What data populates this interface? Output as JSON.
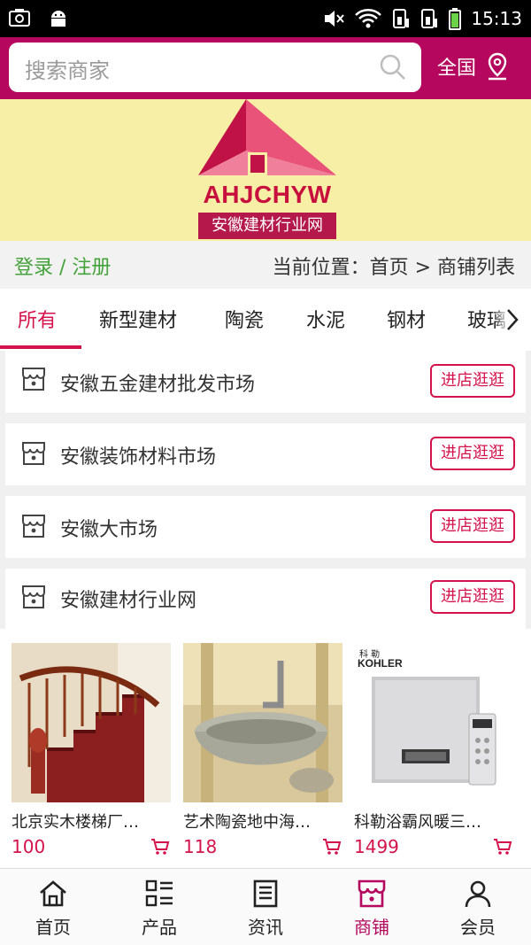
{
  "statusbar": {
    "time": "15:13"
  },
  "header": {
    "search_placeholder": "搜索商家",
    "region": "全国"
  },
  "banner": {
    "logo_text": "AHJCHYW",
    "logo_subtitle": "安徽建材行业网"
  },
  "crumb": {
    "login": "登录 / 注册",
    "location": "当前位置：首页 > 商铺列表"
  },
  "tabs": [
    "所有",
    "新型建材",
    "陶瓷",
    "水泥",
    "钢材",
    "玻璃"
  ],
  "shops": [
    {
      "name": "安徽五金建材批发市场",
      "button": "进店逛逛"
    },
    {
      "name": "安徽装饰材料市场",
      "button": "进店逛逛"
    },
    {
      "name": "安徽大市场",
      "button": "进店逛逛"
    },
    {
      "name": "安徽建材行业网",
      "button": "进店逛逛"
    }
  ],
  "products": [
    {
      "name": "北京实木楼梯厂…",
      "price": "100"
    },
    {
      "name": "艺术陶瓷地中海…",
      "price": "118"
    },
    {
      "name": "科勒浴霸风暖三…",
      "price": "1499",
      "brand": "KOHLER",
      "brand_cn": "科 勒"
    }
  ],
  "nav": [
    {
      "label": "首页",
      "icon": "home-icon"
    },
    {
      "label": "产品",
      "icon": "grid-list-icon"
    },
    {
      "label": "资讯",
      "icon": "news-icon"
    },
    {
      "label": "商铺",
      "icon": "shop-icon"
    },
    {
      "label": "会员",
      "icon": "user-icon"
    }
  ],
  "colors": {
    "brand": "#b5075d",
    "accent": "#d4124c",
    "link": "#44a23a",
    "banner_bg": "#f7efa5"
  }
}
